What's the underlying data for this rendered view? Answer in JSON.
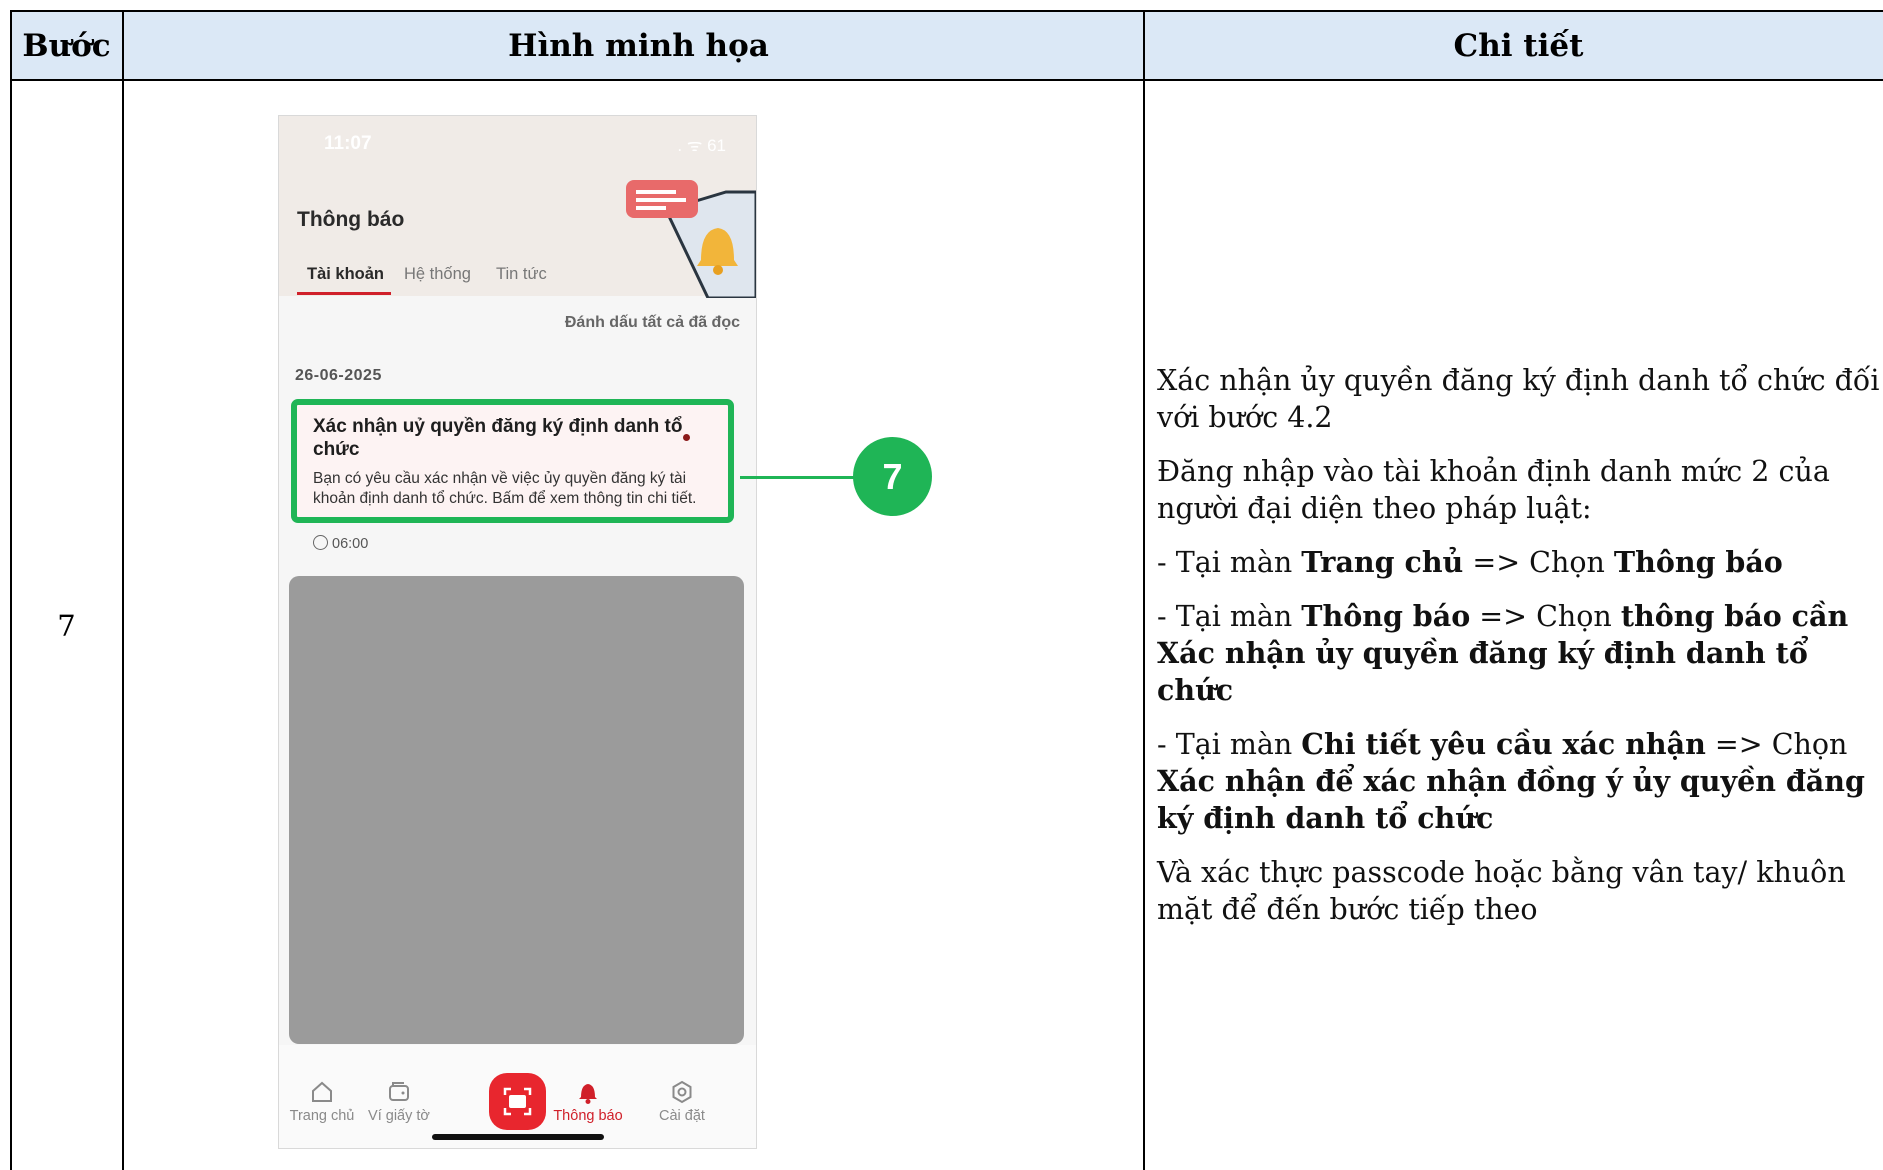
{
  "table": {
    "headers": {
      "step": "Bước",
      "illustration": "Hình minh họa",
      "detail": "Chi tiết"
    },
    "step_number": "7"
  },
  "detail": {
    "p1": "Xác nhận ủy quyền đăng ký định danh tổ chức đối với bước 4.2",
    "p2": "Đăng nhập vào tài khoản định danh mức 2 của người đại diện theo pháp luật:",
    "p3": {
      "pre": "- Tại màn ",
      "b1": "Trang chủ",
      "mid": " => Chọn ",
      "b2": "Thông báo"
    },
    "p4": {
      "pre": "- Tại màn ",
      "b1": "Thông báo",
      "mid": " => Chọn ",
      "b2": "thông báo cần Xác nhận ủy quyền đăng ký định danh tổ chức"
    },
    "p5": {
      "pre": "- Tại màn ",
      "b1": "Chi tiết yêu cầu xác nhận",
      "mid": " => Chọn ",
      "b2": "Xác nhận để xác nhận đồng ý ủy quyền đăng ký định danh tổ chức"
    },
    "p6": "Và xác thực passcode hoặc bằng vân tay/ khuôn mặt để đến bước tiếp theo"
  },
  "phone": {
    "status_time": "11:07",
    "status_icons": ". ᯤ 61",
    "title": "Thông báo",
    "tabs": [
      "Tài khoản",
      "Hệ thống",
      "Tin tức"
    ],
    "mark_all": "Đánh dấu tất cả đã đọc",
    "date": "26-06-2025",
    "notification": {
      "title": "Xác nhận uỷ quyền đăng ký định danh tổ chức",
      "body": "Bạn có yêu cầu xác nhận về việc ủy quyền đăng ký tài khoản định danh tổ chức. Bấm để xem thông tin chi tiết.",
      "time": "06:00"
    },
    "nav": [
      "Trang chủ",
      "Ví giấy tờ",
      "Thông báo",
      "Cài đặt"
    ],
    "callout": "7",
    "colors": {
      "accent_red": "#d0202a",
      "highlight_green": "#1fb556"
    }
  }
}
